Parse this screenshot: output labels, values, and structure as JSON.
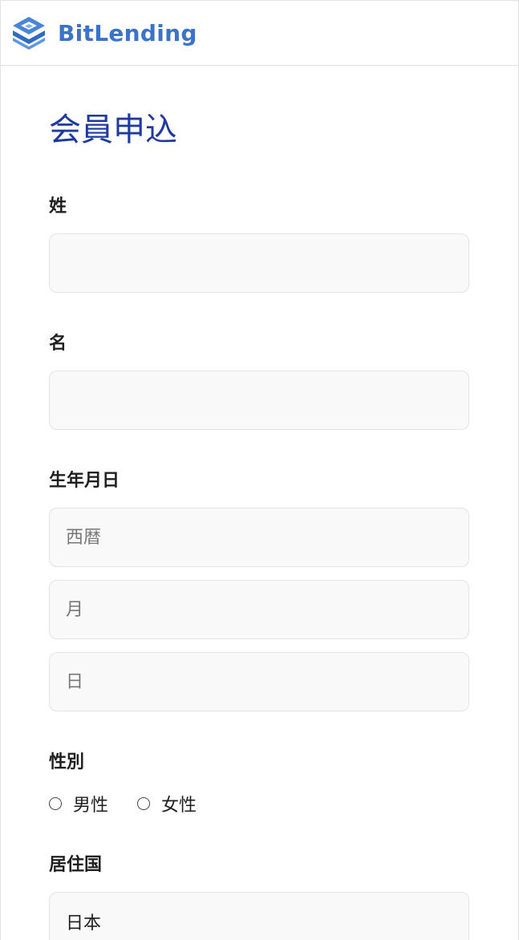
{
  "header": {
    "brand": "BitLending",
    "brand_color": "#3a73c8"
  },
  "form": {
    "title": "会員申込",
    "last_name": {
      "label": "姓",
      "value": "",
      "placeholder": ""
    },
    "first_name": {
      "label": "名",
      "value": "",
      "placeholder": ""
    },
    "birthdate": {
      "label": "生年月日",
      "year_placeholder": "西暦",
      "month_placeholder": "月",
      "day_placeholder": "日"
    },
    "gender": {
      "label": "性別",
      "options": [
        "男性",
        "女性"
      ],
      "selected": null
    },
    "country": {
      "label": "居住国",
      "value": "日本"
    }
  },
  "colors": {
    "title": "#1e3a9e",
    "input_bg": "#f9f9f9",
    "input_border": "#e3e3e3"
  }
}
